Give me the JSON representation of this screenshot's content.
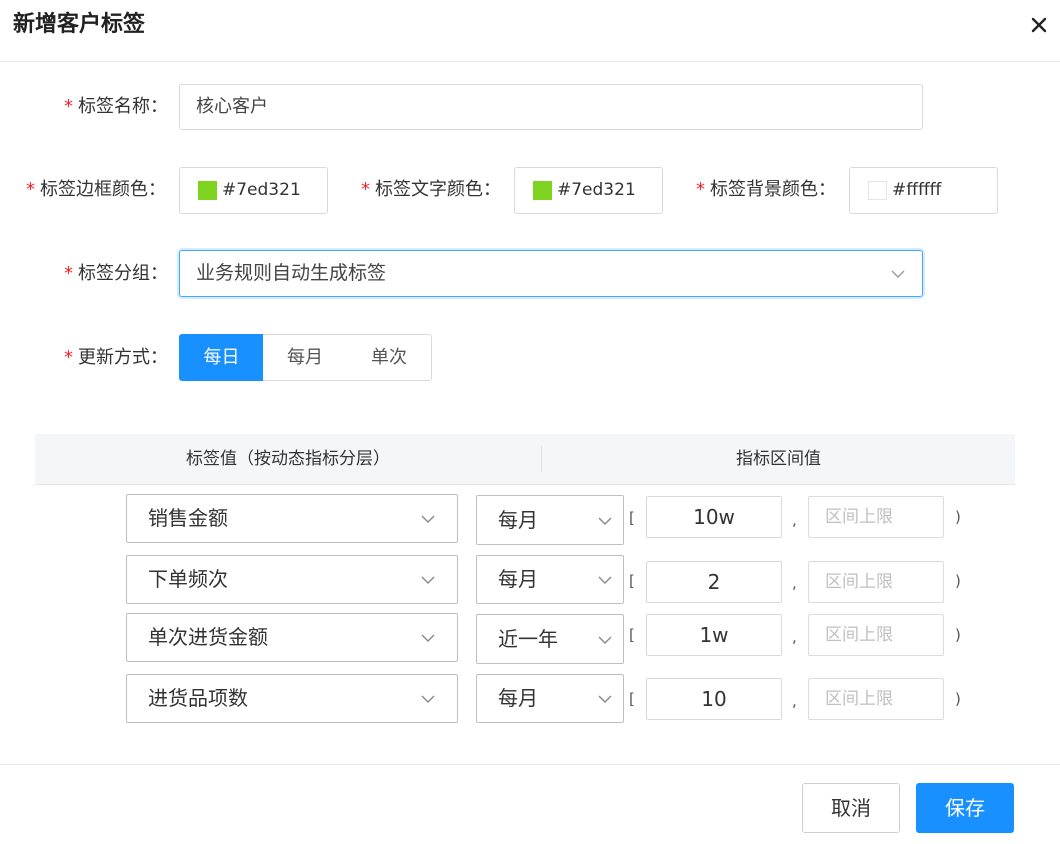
{
  "dialog": {
    "title": "新增客户标签",
    "close_icon": "close-icon"
  },
  "form": {
    "required_mark": "*",
    "name": {
      "label": "标签名称：",
      "value": "核心客户"
    },
    "border_color": {
      "label": "标签边框颜色：",
      "value": "#7ed321",
      "swatch": "#7ed321"
    },
    "text_color": {
      "label": "标签文字颜色：",
      "value": "#7ed321",
      "swatch": "#7ed321"
    },
    "bg_color": {
      "label": "标签背景颜色：",
      "value": "#ffffff",
      "swatch": "#ffffff"
    },
    "group": {
      "label": "标签分组：",
      "value": "业务规则自动生成标签"
    },
    "update": {
      "label": "更新方式：",
      "options": [
        "每日",
        "每月",
        "单次"
      ],
      "selected": "每日"
    }
  },
  "table": {
    "headers": [
      "标签值（按动态指标分层）",
      "指标区间值"
    ],
    "open_bracket": "[",
    "separator": ",",
    "close_bracket": ")",
    "upper_placeholder": "区间上限",
    "rows": [
      {
        "metric": "销售金额",
        "period": "每月",
        "lower": "10w"
      },
      {
        "metric": "下单频次",
        "period": "每月",
        "lower": "2"
      },
      {
        "metric": "单次进货金额",
        "period": "近一年",
        "lower": "1w"
      },
      {
        "metric": "进货品项数",
        "period": "每月",
        "lower": "10"
      }
    ]
  },
  "footer": {
    "cancel_label": "取消",
    "save_label": "保存"
  },
  "colors": {
    "primary": "#1890ff",
    "required": "#f5222d"
  }
}
